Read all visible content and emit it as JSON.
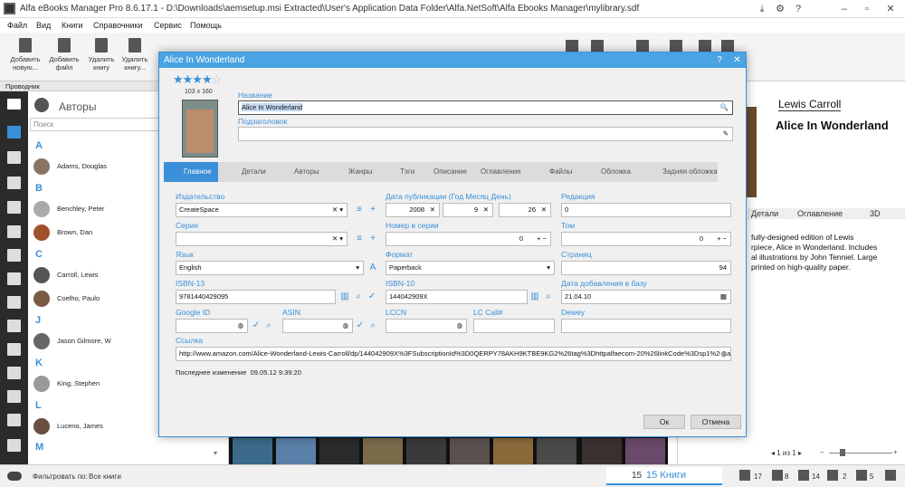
{
  "app": {
    "title": "Alfa eBooks Manager Pro 8.6.17.1 - D:\\Downloads\\aemsetup.msi Extracted\\User's Application Data Folder\\Alfa.NetSoft\\Alfa Ebooks Manager\\mylibrary.sdf"
  },
  "menu": [
    "Файл",
    "Вид",
    "Книги",
    "Справочники",
    "Сервис",
    "Помощь"
  ],
  "ribbon": [
    {
      "label": "Добавить новую...",
      "icon": "add-new-icon"
    },
    {
      "label": "Добавить файл",
      "icon": "add-file-icon"
    },
    {
      "label": "Удалить книгу",
      "icon": "delete-book-icon"
    },
    {
      "label": "Удалить книгу...",
      "icon": "delete-book-file-icon"
    }
  ],
  "explorer": {
    "header": "Проводник",
    "title": "Авторы",
    "search_placeholder": "Поиск",
    "letters": [
      "A",
      "B",
      "C",
      "J",
      "K",
      "L",
      "M"
    ],
    "authors": [
      "Adams, Douglas",
      "Benchley, Peter",
      "Brown, Dan",
      "Carroll, Lewis",
      "Coelho, Paulo",
      "Jason Gilmore, W",
      "King, Stephen",
      "Luceno, James"
    ]
  },
  "dialog": {
    "title": "Alice In Wonderland",
    "rating": 4,
    "cover_size": "103 x 160",
    "name_label": "Название",
    "name_value": "Alice In Wonderland",
    "subtitle_label": "Подзаголовок",
    "subtitle_value": "",
    "tabs": [
      "Главное",
      "Детали",
      "Авторы",
      "Жанры",
      "Тэги",
      "Описание",
      "Оглавление",
      "Файлы",
      "Обложка",
      "Задняя обложка"
    ],
    "publisher_label": "Издательство",
    "publisher_value": "CreateSpace",
    "pubdate_label": "Дата публикации  (Год Месяц День)",
    "pub_year": "2008",
    "pub_month": "9",
    "pub_day": "26",
    "edition_label": "Редакция",
    "edition_value": "0",
    "series_label": "Серия",
    "series_num_label": "Номер в серии",
    "series_num_value": "0",
    "volume_label": "Том",
    "volume_value": "0",
    "lang_label": "Язык",
    "lang_value": "English",
    "format_label": "Формат",
    "format_value": "Paperback",
    "pages_label": "Страниц",
    "pages_value": "94",
    "isbn13_label": "ISBN-13",
    "isbn13_value": "9781440429095",
    "isbn10_label": "ISBN-10",
    "isbn10_value": "144042909X",
    "added_label": "Дата добавления в базу",
    "added_value": "21.04.10",
    "googleid_label": "Google ID",
    "asin_label": "ASIN",
    "lccn_label": "LCCN",
    "lccall_label": "LC Call#",
    "dewey_label": "Dewey",
    "link_label": "Ссылка",
    "link_value": "http://www.amazon.com/Alice-Wonderland-Lewis-Carroll/dp/144042909X%3FSubscriptionId%3D0QERPY78AKH9KTBE9KG2%26tag%3Dhttpalfaecom-20%26linkCode%3Dsp1%26ca",
    "modified_label": "Последнее изменение",
    "modified_value": "09.05.12 9:39:20",
    "ok": "Ок",
    "cancel": "Отмена"
  },
  "details": {
    "author": "Lewis Carroll",
    "title": "Alice In Wonderland",
    "tabs": [
      "Детали",
      "Оглавление",
      "3D"
    ],
    "description": [
      "fully-designed edition of Lewis",
      "rpiece, Alice in Wonderland. Includes",
      "al illustrations by John Tenniel. Large",
      "printed on high-quality paper."
    ],
    "page_nav": "1 из 1"
  },
  "status": {
    "filter_label": "Фильтровать по:",
    "filter_value": "Все книги",
    "count": "15",
    "count_label": "15 Книги",
    "counters": [
      "17",
      "8",
      "14",
      "2",
      "5"
    ]
  },
  "colors": {
    "accent": "#3a8fd8",
    "dialog_title": "#4aa3e3",
    "sidebar": "#2b2b2b"
  }
}
